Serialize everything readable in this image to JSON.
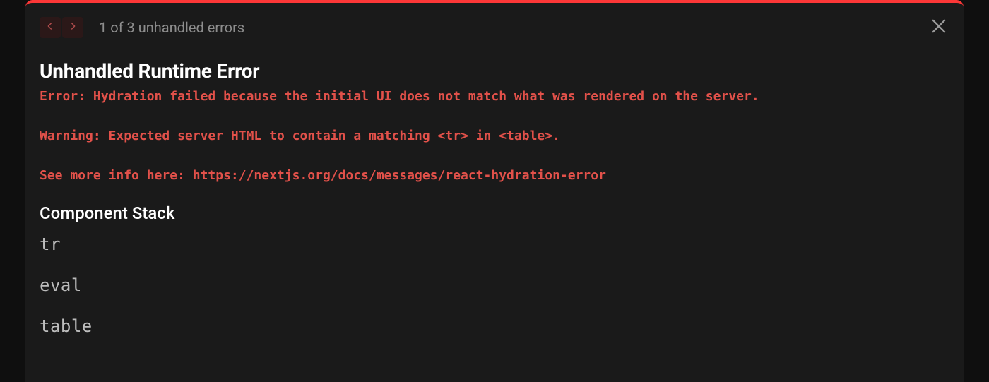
{
  "header": {
    "error_counter": "1 of 3 unhandled errors"
  },
  "error": {
    "title": "Unhandled Runtime Error",
    "message": "Error: Hydration failed because the initial UI does not match what was rendered on the server.\n\nWarning: Expected server HTML to contain a matching <tr> in <table>.\n\nSee more info here: https://nextjs.org/docs/messages/react-hydration-error"
  },
  "stack": {
    "heading": "Component Stack",
    "frames": [
      "tr",
      "eval",
      "table"
    ]
  },
  "colors": {
    "accent": "#fc3737",
    "error_text": "#e2514a",
    "panel": "#1a1a1a",
    "background": "#0f0f0f"
  }
}
